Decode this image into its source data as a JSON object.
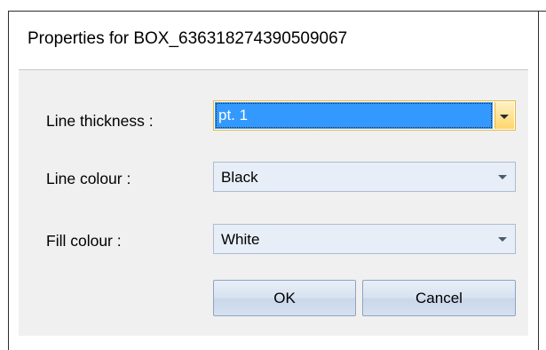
{
  "window": {
    "title": "Properties for BOX_636318274390509067"
  },
  "form": {
    "line_thickness": {
      "label": "Line thickness :",
      "value": "pt. 1"
    },
    "line_colour": {
      "label": "Line colour :",
      "value": "Black"
    },
    "fill_colour": {
      "label": "Fill colour :",
      "value": "White"
    }
  },
  "buttons": {
    "ok_label": "OK",
    "cancel_label": "Cancel"
  },
  "colors": {
    "selection": "#3399ff",
    "focus_border": "#e8b63c",
    "combo_background": "#e7eef7",
    "panel_background": "#f0f0f0"
  },
  "icons": {
    "dropdown": "chevron-down-icon"
  }
}
